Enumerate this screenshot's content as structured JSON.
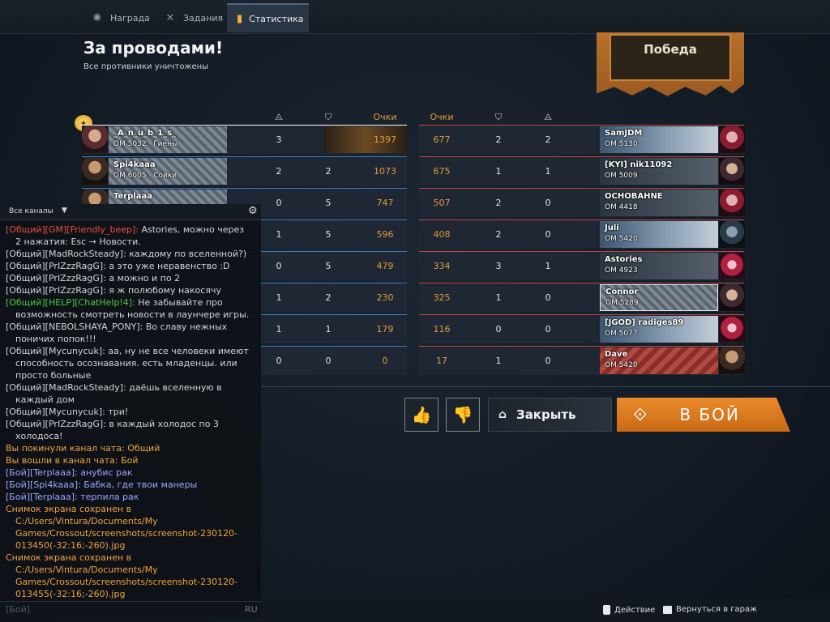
{
  "tabs": [
    {
      "label": "Награда",
      "icon": "gear-icon"
    },
    {
      "label": "Задания",
      "icon": "crossed-swords-icon"
    },
    {
      "label": "Статистика",
      "icon": "stats-icon"
    }
  ],
  "header": {
    "title": "За проводами!",
    "subtitle": "Все противники уничтожены",
    "result": "Победа"
  },
  "columns": {
    "score_left": "Очки",
    "score_right": "Очки"
  },
  "left_team": [
    {
      "name": "_A_n_u_b_1_s_",
      "om": "ОМ 5032 · Гиены",
      "kills": "3",
      "assists": "4",
      "score": "1397"
    },
    {
      "name": "Spi4kaaa",
      "om": "ОМ 6005 · Сойки",
      "kills": "2",
      "assists": "2",
      "score": "1073"
    },
    {
      "name": "Terplaaa",
      "om": "",
      "kills": "0",
      "assists": "5",
      "score": "747"
    },
    {
      "name": "",
      "om": "",
      "kills": "1",
      "assists": "5",
      "score": "596"
    },
    {
      "name": "",
      "om": "",
      "kills": "0",
      "assists": "5",
      "score": "479"
    },
    {
      "name": "",
      "om": "",
      "kills": "1",
      "assists": "2",
      "score": "230"
    },
    {
      "name": "",
      "om": "",
      "kills": "1",
      "assists": "1",
      "score": "179"
    },
    {
      "name": "",
      "om": "",
      "kills": "0",
      "assists": "0",
      "score": "0"
    }
  ],
  "right_team": [
    {
      "name": "SamJDM",
      "om": "ОМ 5130",
      "score": "677",
      "assists": "2",
      "kills": "2"
    },
    {
      "name": "[KYI] nik11092",
      "om": "ОМ 5009",
      "score": "675",
      "assists": "1",
      "kills": "1"
    },
    {
      "name": "OCHOBAHNE",
      "om": "ОМ 4418",
      "score": "507",
      "assists": "2",
      "kills": "0"
    },
    {
      "name": "Juli",
      "om": "ОМ 5420",
      "score": "408",
      "assists": "2",
      "kills": "0"
    },
    {
      "name": "Astories",
      "om": "ОМ 4923",
      "score": "334",
      "assists": "3",
      "kills": "1"
    },
    {
      "name": "Connor",
      "om": "ОМ 5289",
      "score": "325",
      "assists": "1",
      "kills": "0"
    },
    {
      "name": "[JGOD] radiges89",
      "om": "ОМ 5077",
      "score": "116",
      "assists": "0",
      "kills": "0"
    },
    {
      "name": "Dave",
      "om": "ОМ 5420",
      "score": "17",
      "assists": "1",
      "kills": "0"
    }
  ],
  "actions": {
    "close": "Закрыть",
    "fight": "В БОЙ"
  },
  "chat": {
    "channel": "Все каналы",
    "messages": [
      {
        "type": "red",
        "prefix": "[Общий][GM][Friendly_beep]:",
        "text": " Astories, можно через 2 нажатия: Esc → Новости."
      },
      {
        "type": "gray",
        "prefix": "[Общий][MadRockSteady]:",
        "text": " каждому по вселенной?)"
      },
      {
        "type": "gray",
        "prefix": "[Общий][PrIZzzRagG]:",
        "text": " а это уже неравенство :D"
      },
      {
        "type": "gray",
        "prefix": "[Общий][PrIZzzRagG]:",
        "text": " а можно и по 2"
      },
      {
        "type": "gray",
        "prefix": "[Общий][PrIZzzRagG]:",
        "text": " я ж полюбому накосячу"
      },
      {
        "type": "green",
        "prefix": "[Общий][HELP][ChatHelp!4]:",
        "text": " Не забывайте про возможность смотреть новости в лаунчере игры."
      },
      {
        "type": "gray",
        "prefix": "[Общий][NEBOLSHAYA_PONY]:",
        "text": " Во славу нежных поничих попок!!!"
      },
      {
        "type": "gray",
        "prefix": "[Общий][Mycunycuk]:",
        "text": " аа, ну не все человеки имеют способность осознавания. есть младенцы. или просто больные"
      },
      {
        "type": "gray",
        "prefix": "[Общий][MadRockSteady]:",
        "text": " даёшь вселенную в каждый дом"
      },
      {
        "type": "gray",
        "prefix": "[Общий][Mycunycuk]:",
        "text": " три!"
      },
      {
        "type": "gray",
        "prefix": "[Общий][PrIZzzRagG]:",
        "text": " в каждый холодос по 3 холодоса!"
      },
      {
        "type": "sys",
        "prefix": "",
        "text": "Вы покинули канал чата: Общий"
      },
      {
        "type": "sys",
        "prefix": "",
        "text": "Вы вошли в канал чата: Бой"
      },
      {
        "type": "bat",
        "prefix": "[Бой][Terplaaa]:",
        "text": " анубис рак"
      },
      {
        "type": "bat",
        "prefix": "[Бой][Spi4kaaa]:",
        "text": " Бабка, где твои манеры"
      },
      {
        "type": "bat",
        "prefix": "[Бой][Terplaaa]:",
        "text": " терпила рак"
      },
      {
        "type": "sys",
        "prefix": "",
        "text": "Снимок экрана сохранен в C:/Users/Vintura/Documents/My Games/Crossout/screenshots/screenshot-230120-013450(-32:16;-260).jpg"
      },
      {
        "type": "sys",
        "prefix": "",
        "text": "Снимок экрана сохранен в C:/Users/Vintura/Documents/My Games/Crossout/screenshots/screenshot-230120-013455(-32:16;-260).jpg"
      }
    ],
    "input_channel": "[Бой]",
    "lang": "RU"
  },
  "footer": {
    "action": "Действие",
    "garage": "Вернуться в гараж"
  }
}
